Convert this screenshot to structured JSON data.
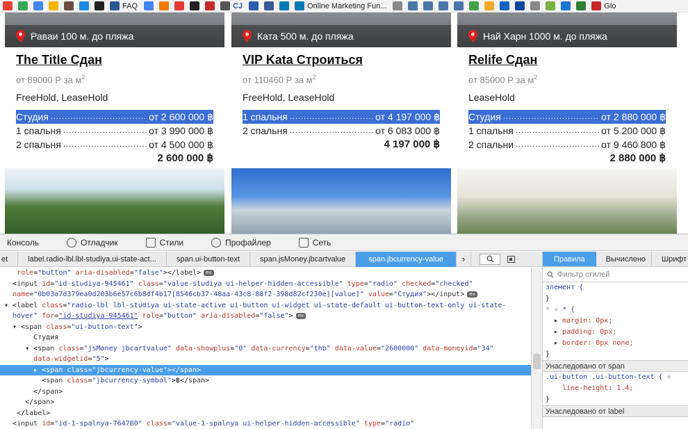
{
  "bookmarks": {
    "items": [
      "FAQ",
      "CJ",
      "Online Marketing Fun...",
      "Glo"
    ]
  },
  "cards": [
    {
      "location": "Раваи 100 м. до пляжа",
      "title": "The Title Сдан",
      "price": "от 89000 Р за м",
      "price_sup": "2",
      "ownership": "FreeHold, LeaseHold",
      "rows": [
        {
          "name": "Студия",
          "price": "от 2 600 000 ฿",
          "selected": true
        },
        {
          "name": "1 спальня",
          "price": "от 3 990 000 ฿",
          "selected": false
        },
        {
          "name": "2 спальня",
          "price": "от 4 500 000 ฿",
          "selected": false
        }
      ],
      "total": "2 600 000 ฿"
    },
    {
      "location": "Ката 500 м. до пляжа",
      "title": "VIP Kata Строиться",
      "price": "от 110460 Р за м",
      "price_sup": "2",
      "ownership": "FreeHold, LeaseHold",
      "rows": [
        {
          "name": "1 спальня",
          "price": "от 4 197 000 ฿",
          "selected": true
        },
        {
          "name": "2 спальня",
          "price": "от 6 083 000 ฿",
          "selected": false
        }
      ],
      "total": "4 197 000 ฿"
    },
    {
      "location": "Най Харн 1000 м. до пляжа",
      "title": "Relife Сдан",
      "price": "от 85000 Р за м",
      "price_sup": "2",
      "ownership": "LeaseHold",
      "rows": [
        {
          "name": "Студия",
          "price": "от 2 880 000 ฿",
          "selected": true
        },
        {
          "name": "1 спальня",
          "price": "от 5 200 000 ฿",
          "selected": false
        },
        {
          "name": "2 спальни",
          "price": "от 9 460 800 ฿",
          "selected": false
        }
      ],
      "total": "2 880 000 ฿"
    }
  ],
  "devtools": {
    "tabs": [
      "Консоль",
      "Отладчик",
      "Стили",
      "Профайлер",
      "Сеть"
    ],
    "breadcrumbs": [
      "et",
      "label.radio-lbl.lbl-studiya.ui-state-act...",
      "span.ui-button-text",
      "span.jsMoney.jbcartvalue",
      "span.jbcurrency-value"
    ],
    "right_tabs": [
      "Правила",
      "Вычислено",
      "Шрифт"
    ],
    "filter_placeholder": "Фильтр стилей",
    "inherit_span": "Унаследовано от span",
    "inherit_label": "Унаследовано от label",
    "rules": {
      "element_selector": "элемент {",
      "close": "}",
      "star": "* {",
      "margin": "margin: 0px;",
      "padding": "padding: 0px;",
      "border": "border: 0px none;",
      "uibutton_selector": ".ui-button .ui-button-text {",
      "line_height": "line-height: 1.4;"
    },
    "source_text": "Студия"
  }
}
